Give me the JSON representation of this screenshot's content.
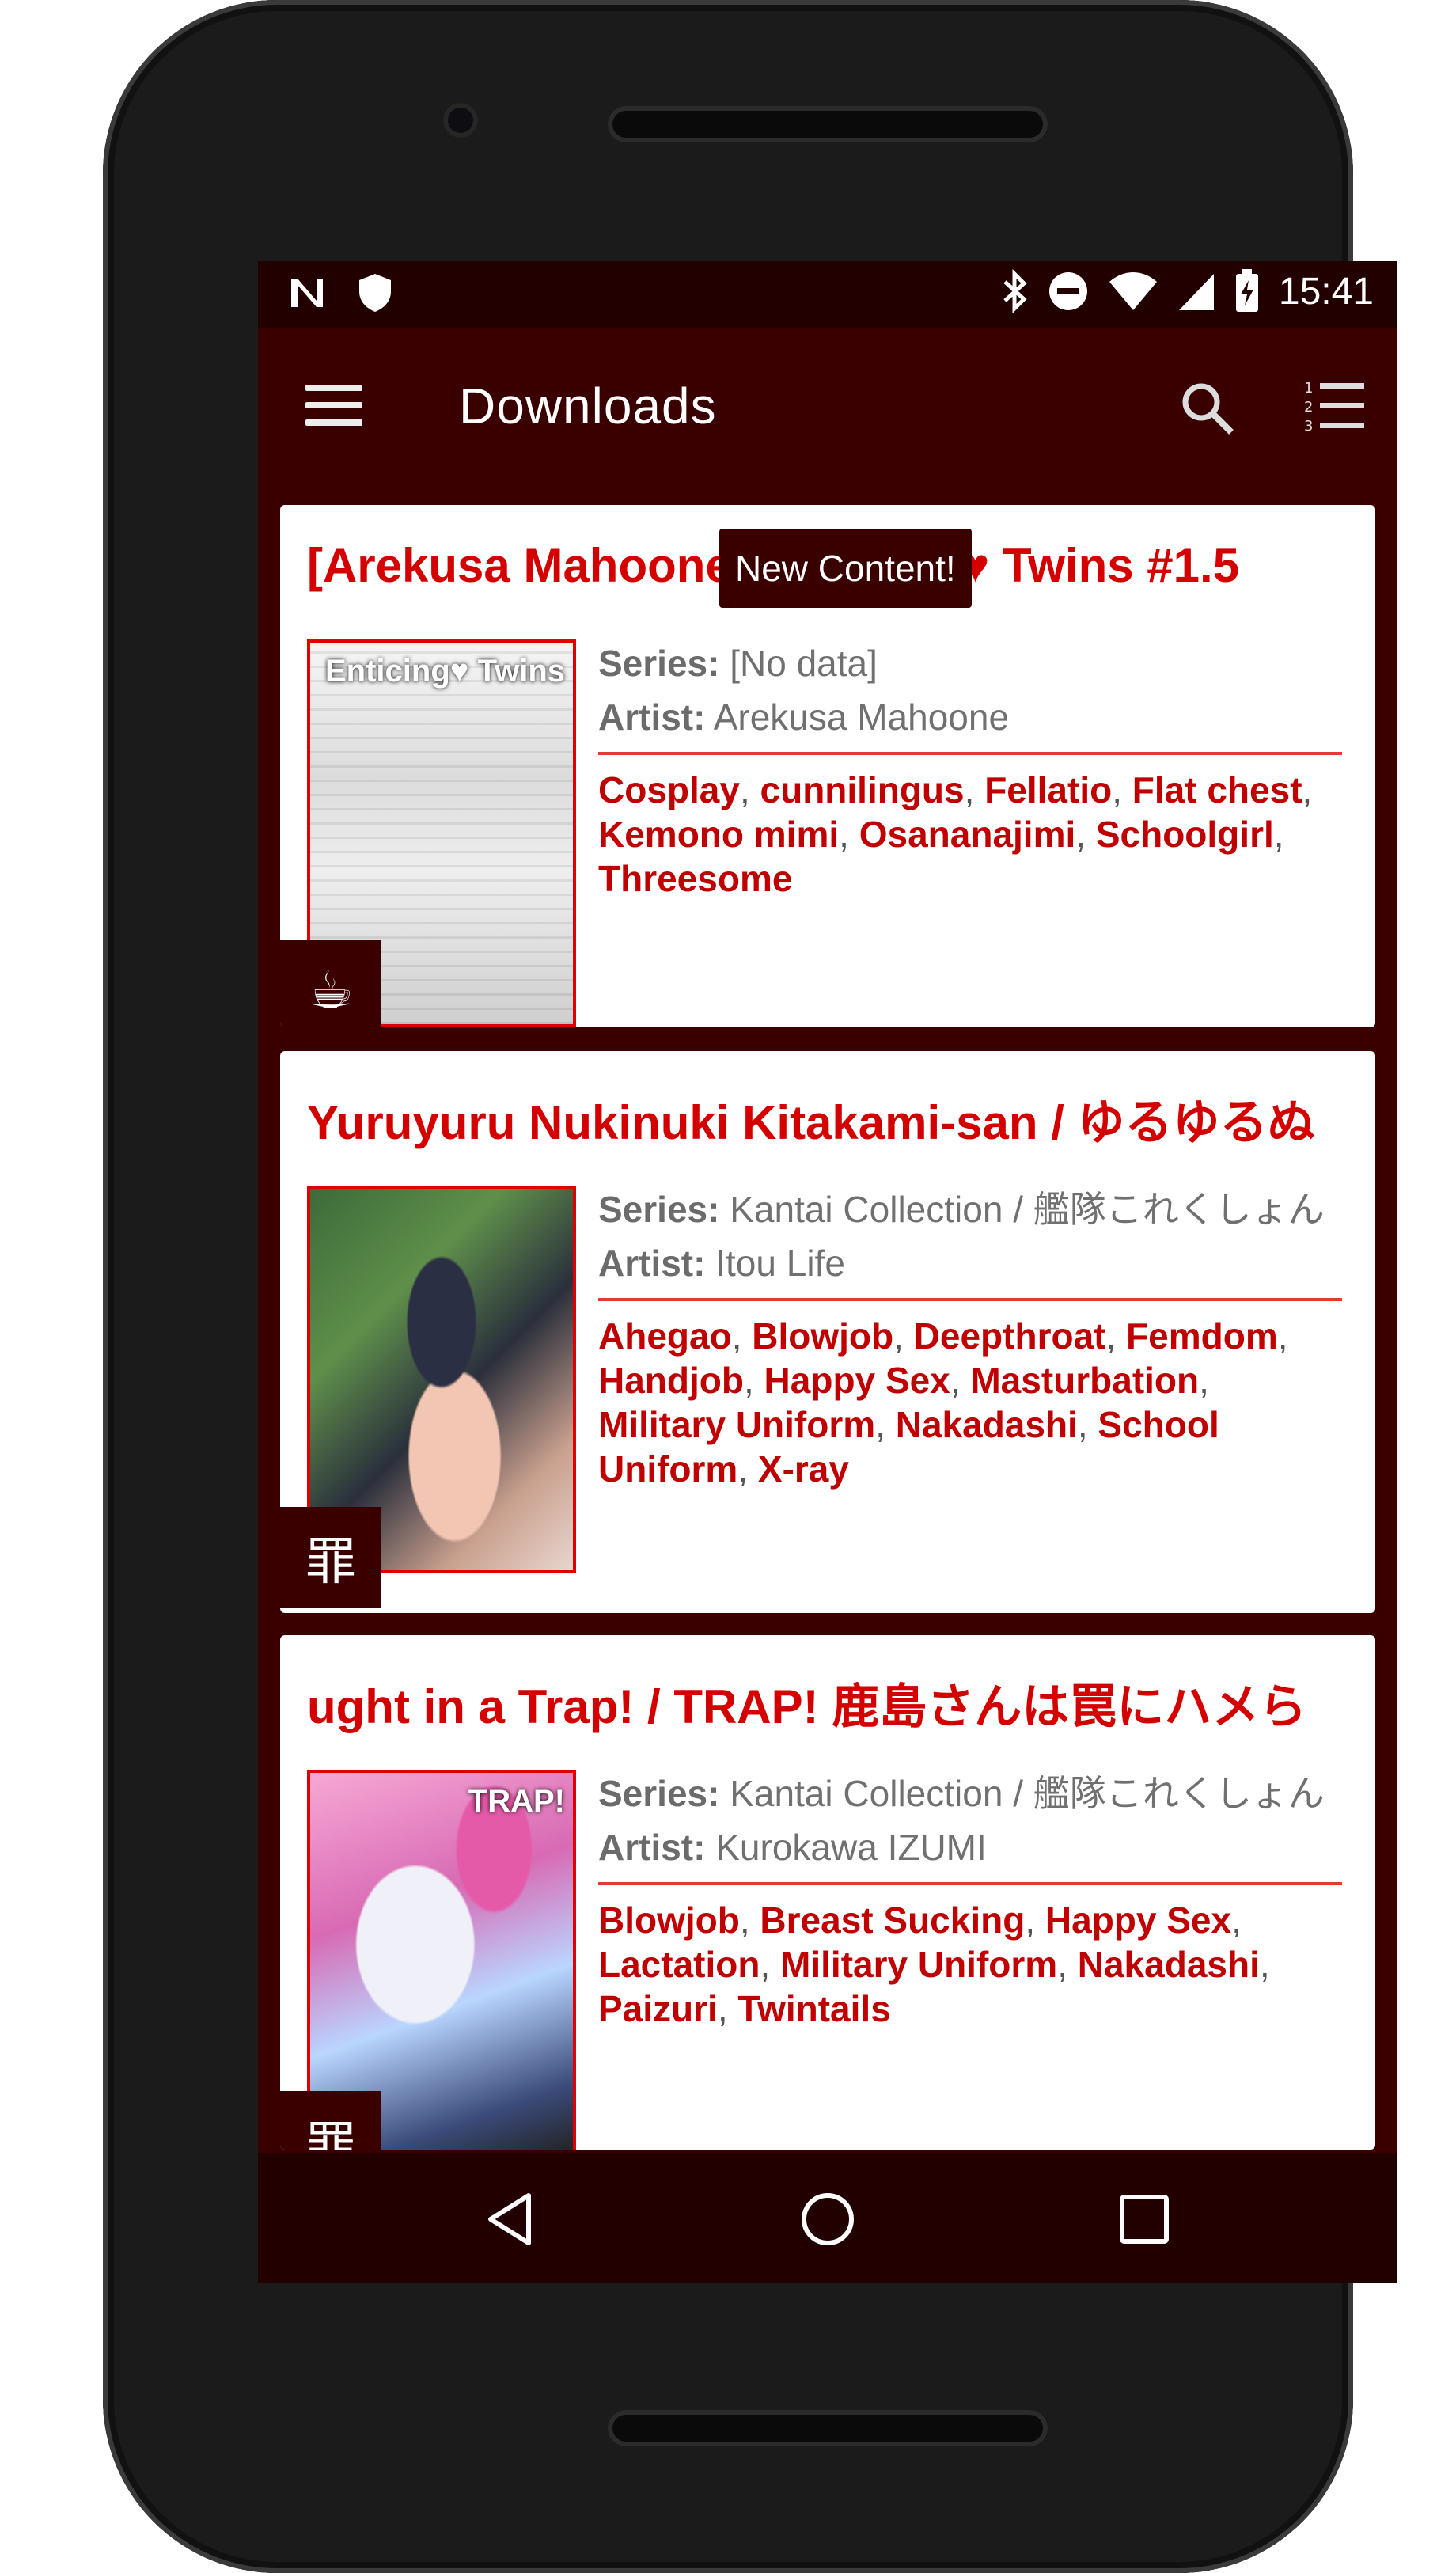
{
  "status_bar": {
    "time": "15:41",
    "left_icons": [
      "n-icon",
      "shield-icon"
    ],
    "right_icons": [
      "bluetooth-icon",
      "do-not-disturb-icon",
      "wifi-icon",
      "cell-signal-icon",
      "battery-charging-icon"
    ]
  },
  "app_bar": {
    "title": "Downloads",
    "menu_icon": "hamburger-menu-icon",
    "search_icon": "search-icon",
    "sort_icon": "numbered-sort-icon"
  },
  "tooltip": "New Content!",
  "cards": [
    {
      "title": "[Arekusa Mahoone] Enticing ♥ Twins #1.5",
      "thumb_caption": "Enticing♥ Twins",
      "badge": "☕",
      "series_label": "Series:",
      "series": "[No data]",
      "artist_label": "Artist:",
      "artist": "Arekusa Mahoone",
      "tags": [
        "Cosplay",
        "cunnilingus",
        "Fellatio",
        "Flat chest",
        "Kemono mimi",
        "Osananajimi",
        "Schoolgirl",
        "Threesome"
      ]
    },
    {
      "title": "Yuruyuru Nukinuki Kitakami-san / ゆるゆるぬ",
      "thumb_caption": "",
      "badge": "罪",
      "series_label": "Series:",
      "series": "Kantai Collection / 艦隊これくしょん",
      "artist_label": "Artist:",
      "artist": "Itou Life",
      "tags": [
        "Ahegao",
        "Blowjob",
        "Deepthroat",
        "Femdom",
        "Handjob",
        "Happy Sex",
        "Masturbation",
        "Military Uniform",
        "Nakadashi",
        "School Uniform",
        "X-ray"
      ]
    },
    {
      "title": "ught in a Trap! / TRAP! 鹿島さんは罠にハメら",
      "thumb_caption": "TRAP!",
      "badge": "罪",
      "series_label": "Series:",
      "series": "Kantai Collection / 艦隊これくしょん",
      "artist_label": "Artist:",
      "artist": "Kurokawa IZUMI",
      "tags": [
        "Blowjob",
        "Breast Sucking",
        "Happy Sex",
        "Lactation",
        "Military Uniform",
        "Nakadashi",
        "Paizuri",
        "Twintails"
      ]
    }
  ],
  "nav_bar": [
    "back-icon",
    "home-icon",
    "recents-icon"
  ],
  "colors": {
    "primary": "#3a0000",
    "status_bar": "#230000",
    "accent": "#d40000",
    "tag": "#c00000"
  }
}
